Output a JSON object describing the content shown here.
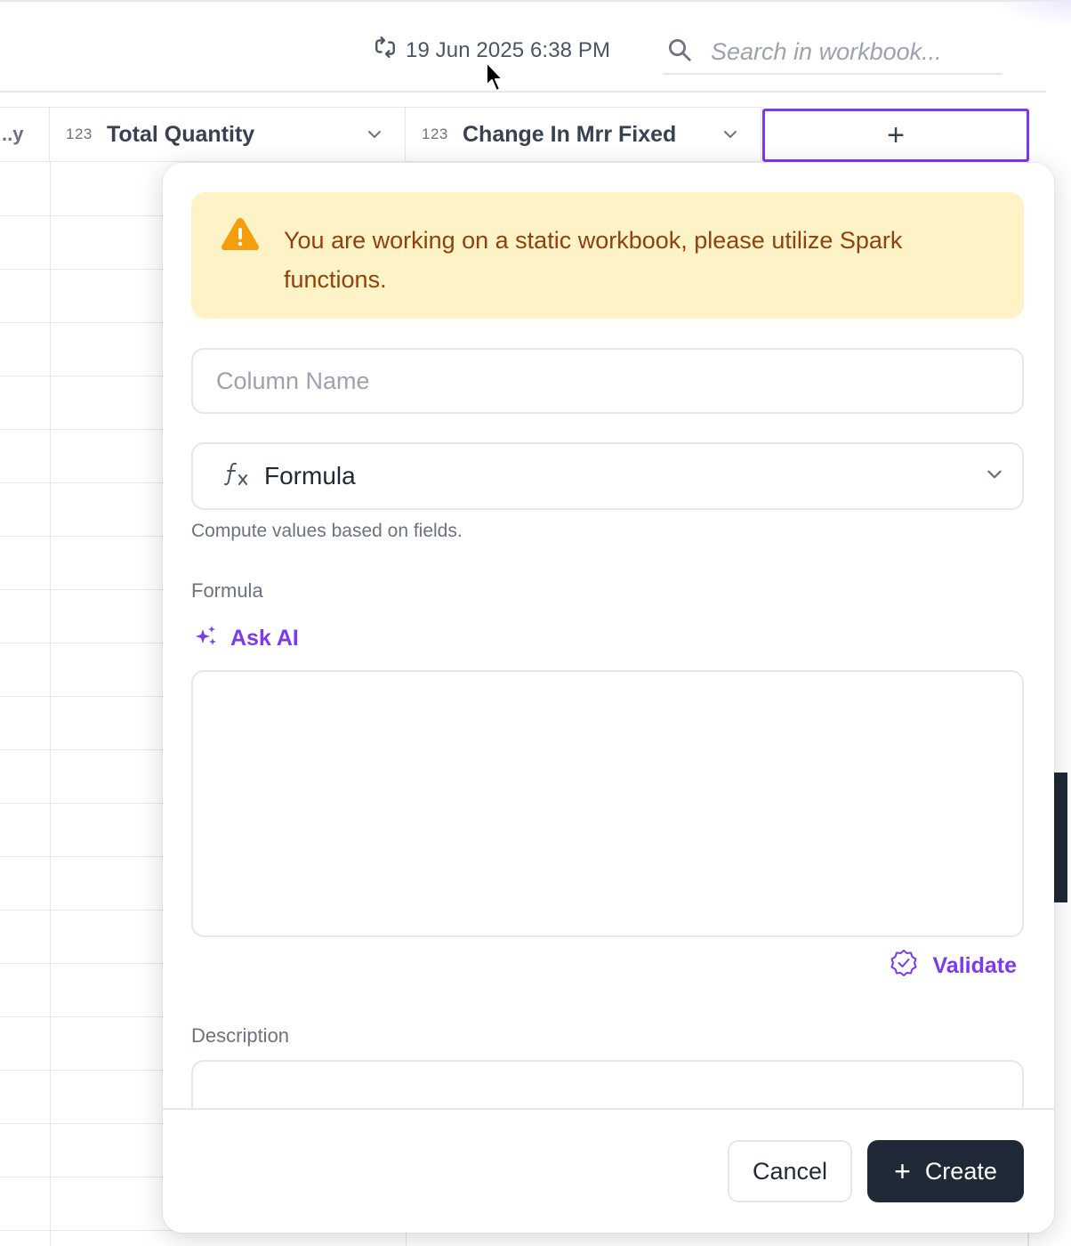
{
  "topbar": {
    "sync_text": "19 Jun 2025 6:38 PM",
    "search_placeholder": "Search in workbook..."
  },
  "columns": [
    {
      "type_badge": "",
      "name": "..y",
      "truncated": true
    },
    {
      "type_badge": "123",
      "name": "Total Quantity"
    },
    {
      "type_badge": "123",
      "name": "Change In Mrr Fixed"
    }
  ],
  "add_column_label": "+",
  "panel": {
    "warning": "You are working on a static workbook, please utilize Spark functions.",
    "column_name_placeholder": "Column Name",
    "column_type": {
      "icon": "fx-icon",
      "selected": "Formula"
    },
    "helper_text": "Compute values based on fields.",
    "formula_label": "Formula",
    "ask_ai_label": "Ask AI",
    "formula_value": "",
    "validate_label": "Validate",
    "description_label": "Description",
    "description_value": "",
    "cancel_label": "Cancel",
    "create_label": "Create",
    "create_icon": "+"
  },
  "colors": {
    "accent": "#7c3aed",
    "warning_bg": "#fef3c7",
    "warning_text": "#92400e",
    "warning_icon": "#f59e0b",
    "primary_button": "#1f2937"
  }
}
